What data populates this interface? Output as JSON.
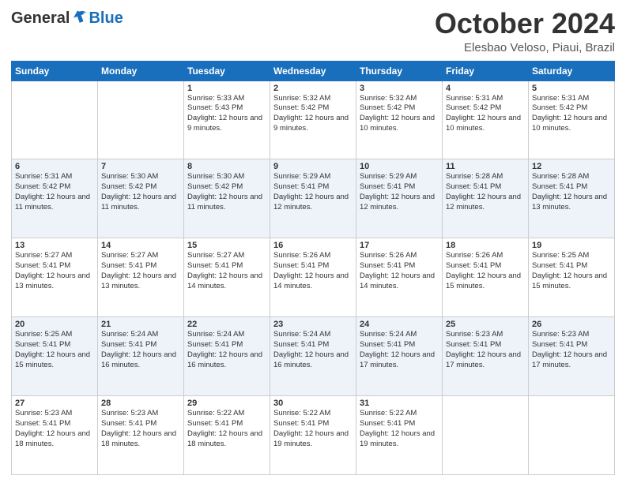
{
  "header": {
    "logo_general": "General",
    "logo_blue": "Blue",
    "month": "October 2024",
    "location": "Elesbao Veloso, Piaui, Brazil"
  },
  "weekdays": [
    "Sunday",
    "Monday",
    "Tuesday",
    "Wednesday",
    "Thursday",
    "Friday",
    "Saturday"
  ],
  "weeks": [
    [
      {
        "day": "",
        "sunrise": "",
        "sunset": "",
        "daylight": ""
      },
      {
        "day": "",
        "sunrise": "",
        "sunset": "",
        "daylight": ""
      },
      {
        "day": "1",
        "sunrise": "Sunrise: 5:33 AM",
        "sunset": "Sunset: 5:43 PM",
        "daylight": "Daylight: 12 hours and 9 minutes."
      },
      {
        "day": "2",
        "sunrise": "Sunrise: 5:32 AM",
        "sunset": "Sunset: 5:42 PM",
        "daylight": "Daylight: 12 hours and 9 minutes."
      },
      {
        "day": "3",
        "sunrise": "Sunrise: 5:32 AM",
        "sunset": "Sunset: 5:42 PM",
        "daylight": "Daylight: 12 hours and 10 minutes."
      },
      {
        "day": "4",
        "sunrise": "Sunrise: 5:31 AM",
        "sunset": "Sunset: 5:42 PM",
        "daylight": "Daylight: 12 hours and 10 minutes."
      },
      {
        "day": "5",
        "sunrise": "Sunrise: 5:31 AM",
        "sunset": "Sunset: 5:42 PM",
        "daylight": "Daylight: 12 hours and 10 minutes."
      }
    ],
    [
      {
        "day": "6",
        "sunrise": "Sunrise: 5:31 AM",
        "sunset": "Sunset: 5:42 PM",
        "daylight": "Daylight: 12 hours and 11 minutes."
      },
      {
        "day": "7",
        "sunrise": "Sunrise: 5:30 AM",
        "sunset": "Sunset: 5:42 PM",
        "daylight": "Daylight: 12 hours and 11 minutes."
      },
      {
        "day": "8",
        "sunrise": "Sunrise: 5:30 AM",
        "sunset": "Sunset: 5:42 PM",
        "daylight": "Daylight: 12 hours and 11 minutes."
      },
      {
        "day": "9",
        "sunrise": "Sunrise: 5:29 AM",
        "sunset": "Sunset: 5:41 PM",
        "daylight": "Daylight: 12 hours and 12 minutes."
      },
      {
        "day": "10",
        "sunrise": "Sunrise: 5:29 AM",
        "sunset": "Sunset: 5:41 PM",
        "daylight": "Daylight: 12 hours and 12 minutes."
      },
      {
        "day": "11",
        "sunrise": "Sunrise: 5:28 AM",
        "sunset": "Sunset: 5:41 PM",
        "daylight": "Daylight: 12 hours and 12 minutes."
      },
      {
        "day": "12",
        "sunrise": "Sunrise: 5:28 AM",
        "sunset": "Sunset: 5:41 PM",
        "daylight": "Daylight: 12 hours and 13 minutes."
      }
    ],
    [
      {
        "day": "13",
        "sunrise": "Sunrise: 5:27 AM",
        "sunset": "Sunset: 5:41 PM",
        "daylight": "Daylight: 12 hours and 13 minutes."
      },
      {
        "day": "14",
        "sunrise": "Sunrise: 5:27 AM",
        "sunset": "Sunset: 5:41 PM",
        "daylight": "Daylight: 12 hours and 13 minutes."
      },
      {
        "day": "15",
        "sunrise": "Sunrise: 5:27 AM",
        "sunset": "Sunset: 5:41 PM",
        "daylight": "Daylight: 12 hours and 14 minutes."
      },
      {
        "day": "16",
        "sunrise": "Sunrise: 5:26 AM",
        "sunset": "Sunset: 5:41 PM",
        "daylight": "Daylight: 12 hours and 14 minutes."
      },
      {
        "day": "17",
        "sunrise": "Sunrise: 5:26 AM",
        "sunset": "Sunset: 5:41 PM",
        "daylight": "Daylight: 12 hours and 14 minutes."
      },
      {
        "day": "18",
        "sunrise": "Sunrise: 5:26 AM",
        "sunset": "Sunset: 5:41 PM",
        "daylight": "Daylight: 12 hours and 15 minutes."
      },
      {
        "day": "19",
        "sunrise": "Sunrise: 5:25 AM",
        "sunset": "Sunset: 5:41 PM",
        "daylight": "Daylight: 12 hours and 15 minutes."
      }
    ],
    [
      {
        "day": "20",
        "sunrise": "Sunrise: 5:25 AM",
        "sunset": "Sunset: 5:41 PM",
        "daylight": "Daylight: 12 hours and 15 minutes."
      },
      {
        "day": "21",
        "sunrise": "Sunrise: 5:24 AM",
        "sunset": "Sunset: 5:41 PM",
        "daylight": "Daylight: 12 hours and 16 minutes."
      },
      {
        "day": "22",
        "sunrise": "Sunrise: 5:24 AM",
        "sunset": "Sunset: 5:41 PM",
        "daylight": "Daylight: 12 hours and 16 minutes."
      },
      {
        "day": "23",
        "sunrise": "Sunrise: 5:24 AM",
        "sunset": "Sunset: 5:41 PM",
        "daylight": "Daylight: 12 hours and 16 minutes."
      },
      {
        "day": "24",
        "sunrise": "Sunrise: 5:24 AM",
        "sunset": "Sunset: 5:41 PM",
        "daylight": "Daylight: 12 hours and 17 minutes."
      },
      {
        "day": "25",
        "sunrise": "Sunrise: 5:23 AM",
        "sunset": "Sunset: 5:41 PM",
        "daylight": "Daylight: 12 hours and 17 minutes."
      },
      {
        "day": "26",
        "sunrise": "Sunrise: 5:23 AM",
        "sunset": "Sunset: 5:41 PM",
        "daylight": "Daylight: 12 hours and 17 minutes."
      }
    ],
    [
      {
        "day": "27",
        "sunrise": "Sunrise: 5:23 AM",
        "sunset": "Sunset: 5:41 PM",
        "daylight": "Daylight: 12 hours and 18 minutes."
      },
      {
        "day": "28",
        "sunrise": "Sunrise: 5:23 AM",
        "sunset": "Sunset: 5:41 PM",
        "daylight": "Daylight: 12 hours and 18 minutes."
      },
      {
        "day": "29",
        "sunrise": "Sunrise: 5:22 AM",
        "sunset": "Sunset: 5:41 PM",
        "daylight": "Daylight: 12 hours and 18 minutes."
      },
      {
        "day": "30",
        "sunrise": "Sunrise: 5:22 AM",
        "sunset": "Sunset: 5:41 PM",
        "daylight": "Daylight: 12 hours and 19 minutes."
      },
      {
        "day": "31",
        "sunrise": "Sunrise: 5:22 AM",
        "sunset": "Sunset: 5:41 PM",
        "daylight": "Daylight: 12 hours and 19 minutes."
      },
      {
        "day": "",
        "sunrise": "",
        "sunset": "",
        "daylight": ""
      },
      {
        "day": "",
        "sunrise": "",
        "sunset": "",
        "daylight": ""
      }
    ]
  ]
}
